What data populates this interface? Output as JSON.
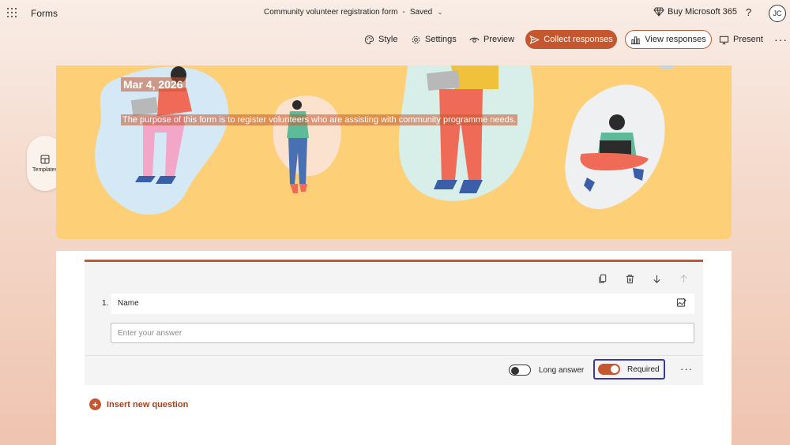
{
  "app": {
    "name": "Forms"
  },
  "document": {
    "title": "Community volunteer registration form",
    "separator": "-",
    "status": "Saved"
  },
  "header": {
    "buy_label": "Buy Microsoft 365",
    "help_label": "?",
    "avatar_initials": "JC"
  },
  "toolbar": {
    "style_label": "Style",
    "settings_label": "Settings",
    "preview_label": "Preview",
    "collect_label": "Collect responses",
    "view_label": "View responses",
    "present_label": "Present",
    "more_label": "···"
  },
  "sidebar": {
    "templates_label": "Templates"
  },
  "banner": {
    "date": "Mar 4, 2026",
    "description": "The purpose of this form is to register volunteers who are assisting with community programme needs."
  },
  "question": {
    "number": "1.",
    "title": "Name",
    "answer_placeholder": "Enter your answer",
    "long_answer_label": "Long answer",
    "long_answer_on": false,
    "required_label": "Required",
    "required_on": true,
    "more_label": "···"
  },
  "insert": {
    "label": "Insert new question",
    "icon": "+"
  },
  "colors": {
    "accent": "#c4572f",
    "banner": "#fdd077"
  }
}
